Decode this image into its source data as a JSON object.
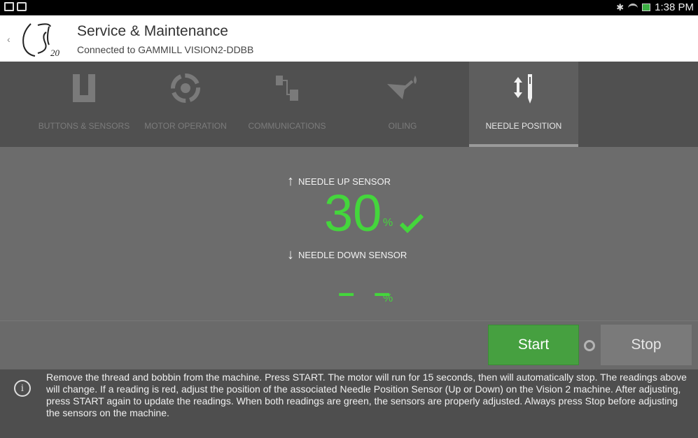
{
  "statusbar": {
    "time": "1:38 PM",
    "bluetooth": "✱"
  },
  "header": {
    "title": "Service & Maintenance",
    "subtitle": "Connected to GAMMILL VISION2-DDBB",
    "back_glyph": "‹"
  },
  "tabs": [
    {
      "label": "BUTTONS & SENSORS",
      "icon": "sensor-icon"
    },
    {
      "label": "MOTOR OPERATION",
      "icon": "motor-icon"
    },
    {
      "label": "COMMUNICATIONS",
      "icon": "communications-icon"
    },
    {
      "label": "OILING",
      "icon": "oil-can-icon"
    },
    {
      "label": "NEEDLE POSITION",
      "icon": "needle-icon",
      "active": true
    }
  ],
  "needle": {
    "up_label": "NEEDLE UP SENSOR",
    "up_value": "30",
    "up_unit": "%",
    "down_label": "NEEDLE DOWN SENSOR",
    "down_value": "– –",
    "down_unit": "%",
    "up_arrow": "↑",
    "down_arrow": "↓"
  },
  "actions": {
    "start_label": "Start",
    "stop_label": "Stop"
  },
  "info": {
    "icon_glyph": "i",
    "text": "Remove the thread and bobbin from the machine. Press START. The motor will run for 15 seconds, then will automatically stop. The readings above will change. If a reading is red, adjust the position of the associated Needle Position Sensor (Up or Down) on the Vision 2 machine. After adjusting, press START again to update the readings. When both readings are green, the sensors are properly adjusted. Always press Stop before adjusting the sensors on the machine."
  },
  "colors": {
    "green": "#44d63c",
    "start_button": "#46a040"
  }
}
